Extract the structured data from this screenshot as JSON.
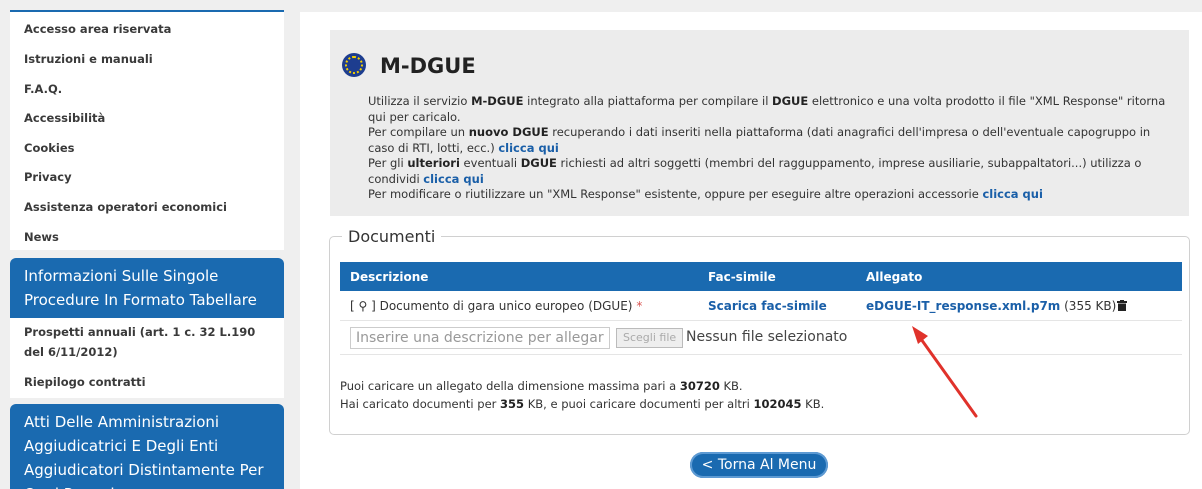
{
  "sidebar": {
    "menu1": [
      "Accesso area riservata",
      "Istruzioni e manuali",
      "F.A.Q.",
      "Accessibilità",
      "Cookies",
      "Privacy",
      "Assistenza operatori economici",
      "News"
    ],
    "heading1": "Informazioni Sulle Singole Procedure In Formato Tabellare",
    "menu2": [
      "Prospetti annuali (art. 1 c. 32 L.190 del 6/11/2012)",
      "Riepilogo contratti"
    ],
    "heading2": "Atti Delle Amministrazioni Aggiudicatrici E Degli Enti Aggiudicatori Distintamente Per Ogni Procedura"
  },
  "mdgue": {
    "title": "M-DGUE",
    "p1_a": "Utilizza il servizio ",
    "p1_b": "M-DGUE",
    "p1_c": " integrato alla piattaforma per compilare il ",
    "p1_d": "DGUE",
    "p1_e": " elettronico e una volta prodotto il file \"XML Response\" ritorna qui per caricalo.",
    "p2_a": "Per compilare un ",
    "p2_b": "nuovo DGUE",
    "p2_c": " recuperando i dati inseriti nella piattaforma (dati anagrafici dell'impresa o dell'eventuale capogruppo in caso di RTI, lotti, ecc.) ",
    "p2_link": "clicca qui",
    "p3_a": "Per gli ",
    "p3_b": "ulteriori",
    "p3_c": " eventuali ",
    "p3_d": "DGUE",
    "p3_e": " richiesti ad altri soggetti (membri del ragguppamento, imprese ausiliarie, subappaltatori...) utilizza o condividi ",
    "p3_link": "clicca qui",
    "p4_a": "Per modificare o riutilizzare un \"XML Response\" esistente, oppure per eseguire altre operazioni accessorie ",
    "p4_link": "clicca qui"
  },
  "documenti": {
    "legend": "Documenti",
    "headers": {
      "descrizione": "Descrizione",
      "facsimile": "Fac-simile",
      "allegato": "Allegato"
    },
    "row": {
      "descrizione": "[ ⚲ ] Documento di gara unico europeo (DGUE)",
      "required": "*",
      "facsimile": "Scarica fac-simile",
      "allegato": "eDGUE-IT_response.xml.p7m",
      "size": "(355 KB)"
    },
    "input_placeholder": "Inserire una descrizione per allegare u",
    "file_button": "Scegli file",
    "file_status": "Nessun file selezionato",
    "info1_a": "Puoi caricare un allegato della dimensione massima pari a ",
    "info1_b": "30720",
    "info1_c": " KB.",
    "info2_a": "Hai caricato documenti per ",
    "info2_b": "355",
    "info2_c": " KB, e puoi caricare documenti per altri ",
    "info2_d": "102045",
    "info2_e": " KB."
  },
  "back_button": "< Torna Al Menu",
  "colors": {
    "accent": "#1a6ab0",
    "link": "#1a5fa8",
    "arrow": "#e0322b"
  },
  "icons": [
    "eu-flag-icon",
    "trash-icon",
    "annotation-arrow"
  ]
}
